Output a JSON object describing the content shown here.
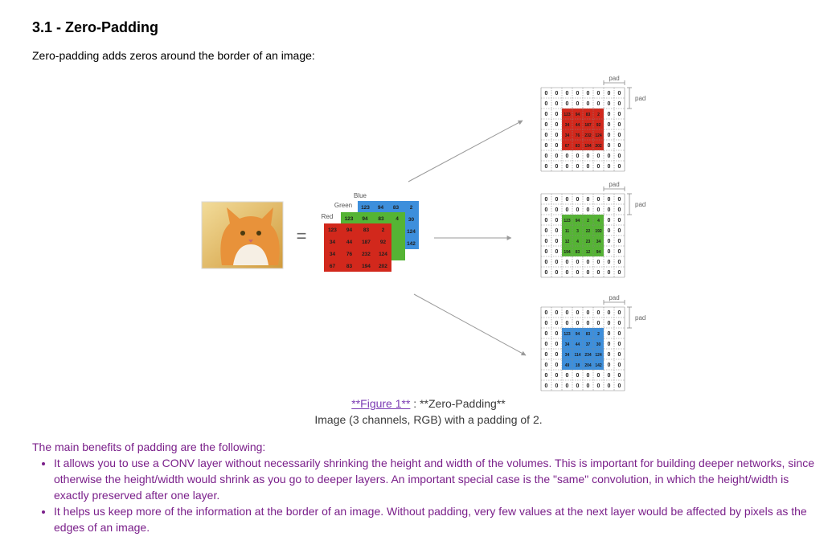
{
  "heading": "3.1 - Zero-Padding",
  "intro": "Zero-padding adds zeros around the border of an image:",
  "figure": {
    "equals": "=",
    "channel_labels": {
      "blue": "Blue",
      "green": "Green",
      "red": "Red"
    },
    "pad_label": "pad",
    "zero": "0",
    "colors": {
      "red": "#d2281c",
      "green": "#55b434",
      "blue": "#3d8fdc"
    },
    "channels": {
      "red": [
        [
          "123",
          "94",
          "83",
          "2"
        ],
        [
          "34",
          "44",
          "187",
          "92"
        ],
        [
          "34",
          "76",
          "232",
          "124"
        ],
        [
          "67",
          "83",
          "194",
          "202"
        ]
      ],
      "green": [
        [
          "123",
          "94",
          "83",
          "4"
        ],
        [
          "",
          "",
          "",
          ""
        ],
        [
          "",
          "",
          "",
          ""
        ],
        [
          "",
          "",
          "",
          ""
        ]
      ],
      "blue": [
        [
          "123",
          "94",
          "83",
          "2"
        ],
        [
          "",
          "",
          "",
          "30"
        ],
        [
          "",
          "",
          "",
          "124"
        ],
        [
          "",
          "",
          "",
          "142"
        ]
      ]
    },
    "padded": {
      "red": [
        [
          "123",
          "94",
          "83",
          "2"
        ],
        [
          "34",
          "44",
          "187",
          "92"
        ],
        [
          "34",
          "76",
          "232",
          "124"
        ],
        [
          "67",
          "83",
          "194",
          "202"
        ]
      ],
      "green": [
        [
          "123",
          "94",
          "2",
          "4"
        ],
        [
          "11",
          "3",
          "22",
          "192"
        ],
        [
          "12",
          "4",
          "23",
          "34"
        ],
        [
          "194",
          "83",
          "12",
          "94"
        ]
      ],
      "blue": [
        [
          "123",
          "94",
          "83",
          "2"
        ],
        [
          "34",
          "44",
          "37",
          "30"
        ],
        [
          "34",
          "114",
          "234",
          "124"
        ],
        [
          "49",
          "18",
          "204",
          "142"
        ]
      ]
    },
    "caption_link": "**Figure 1**",
    "caption_rest": " : **Zero-Padding**",
    "caption_line2": "Image (3 channels, RGB) with a padding of 2."
  },
  "benefits_intro": "The main benefits of padding are the following:",
  "bullets": [
    "It allows you to use a CONV layer without necessarily shrinking the height and width of the volumes. This is important for building deeper networks, since otherwise the height/width would shrink as you go to deeper layers. An important special case is the \"same\" convolution, in which the height/width is exactly preserved after one layer.",
    "It helps us keep more of the information at the border of an image. Without padding, very few values at the next layer would be affected by pixels as the edges of an image."
  ]
}
